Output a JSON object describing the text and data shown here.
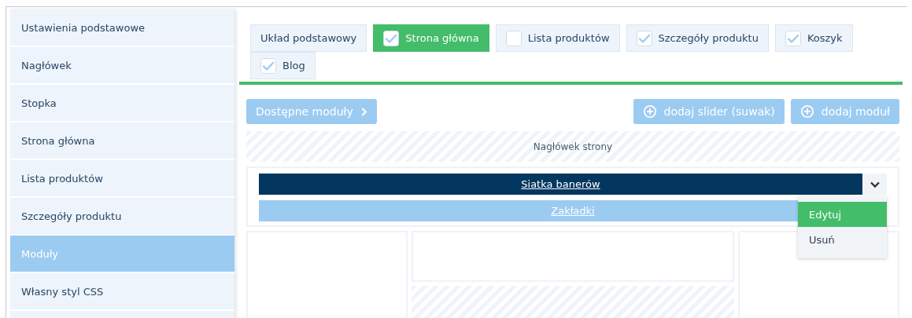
{
  "sidebar": {
    "items": [
      {
        "label": "Ustawienia podstawowe",
        "selected": false
      },
      {
        "label": "Nagłówek",
        "selected": false
      },
      {
        "label": "Stopka",
        "selected": false
      },
      {
        "label": "Strona główna",
        "selected": false
      },
      {
        "label": "Lista produktów",
        "selected": false
      },
      {
        "label": "Szczegóły produktu",
        "selected": false
      },
      {
        "label": "Moduły",
        "selected": true
      },
      {
        "label": "Własny styl CSS",
        "selected": false
      }
    ]
  },
  "tabs": [
    {
      "label": "Układ podstawowy",
      "kind": "plain",
      "selected": false
    },
    {
      "label": "Strona główna",
      "kind": "checkbox",
      "checked": true,
      "selected": true
    },
    {
      "label": "Lista produktów",
      "kind": "checkbox",
      "checked": false,
      "selected": false
    },
    {
      "label": "Szczegóły produktu",
      "kind": "checkbox",
      "checked": true,
      "selected": false
    },
    {
      "label": "Koszyk",
      "kind": "checkbox",
      "checked": true,
      "selected": false
    },
    {
      "label": "Blog",
      "kind": "checkbox",
      "checked": true,
      "selected": false
    }
  ],
  "toolbar": {
    "available_button": "Dostępne moduły",
    "add_slider_button": "dodaj slider (suwak)",
    "add_module_button": "dodaj moduł"
  },
  "header_zone": "Nagłówek strony",
  "modules": [
    {
      "label": "Siatka banerów",
      "selected": true,
      "menu_open": true
    },
    {
      "label": "Zakładki",
      "selected": false,
      "menu_open": false
    }
  ],
  "module_menu": [
    {
      "label": "Edytuj",
      "selected": true
    },
    {
      "label": "Usuń",
      "selected": false
    }
  ]
}
